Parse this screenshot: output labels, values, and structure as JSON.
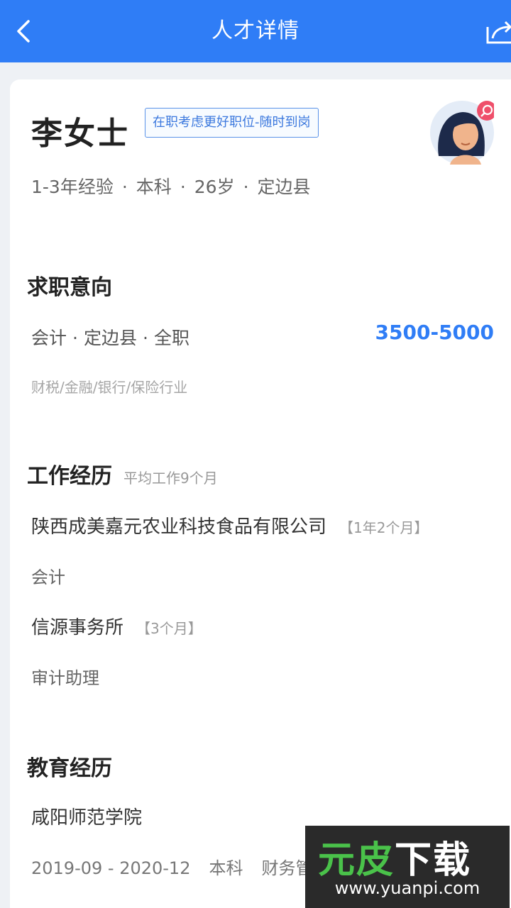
{
  "app_bar": {
    "title": "人才详情"
  },
  "profile": {
    "name": "李女士",
    "status_tag": "在职考虑更好职位-随时到岗",
    "meta": [
      "1-3年经验",
      "本科",
      "26岁",
      "定边县"
    ],
    "separator": "·"
  },
  "intent": {
    "title": "求职意向",
    "job": "会计",
    "location": "定边县",
    "type": "全职",
    "salary": "3500-5000",
    "industry": "财税/金融/银行/保险行业"
  },
  "work": {
    "title": "工作经历",
    "subtitle": "平均工作9个月",
    "items": [
      {
        "company": "陕西成美嘉元农业科技食品有限公司",
        "duration": "【1年2个月】",
        "role": "会计"
      },
      {
        "company": "信源事务所",
        "duration": "【3个月】",
        "role": "审计助理"
      }
    ]
  },
  "education": {
    "title": "教育经历",
    "school": "咸阳师范学院",
    "period": "2019-09 - 2020-12",
    "degree": "本科",
    "major": "财务管"
  },
  "watermark": {
    "logo_a": "元皮",
    "logo_b": "下载",
    "url": "www.yuanpi.com"
  },
  "colors": {
    "accent": "#2f7df6",
    "background": "#eef1f5"
  }
}
